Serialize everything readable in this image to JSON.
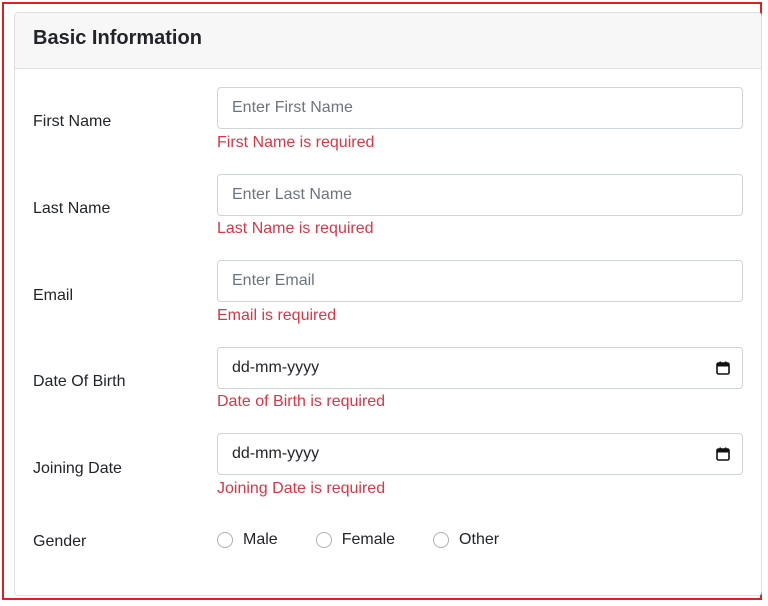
{
  "card": {
    "title": "Basic Information"
  },
  "fields": {
    "first_name": {
      "label": "First Name",
      "placeholder": "Enter First Name",
      "error": "First Name is required"
    },
    "last_name": {
      "label": "Last Name",
      "placeholder": "Enter Last Name",
      "error": "Last Name is required"
    },
    "email": {
      "label": "Email",
      "placeholder": "Enter Email",
      "error": "Email is required"
    },
    "dob": {
      "label": "Date Of Birth",
      "value": "dd-mm-yyyy",
      "error": "Date of Birth is required"
    },
    "joining_date": {
      "label": "Joining Date",
      "value": "dd-mm-yyyy",
      "error": "Joining Date is required"
    },
    "gender": {
      "label": "Gender",
      "options": [
        "Male",
        "Female",
        "Other"
      ]
    }
  },
  "colors": {
    "error": "#dc3545",
    "frame_border": "#e02020"
  },
  "icons": {
    "date_picker": "calendar-icon"
  }
}
